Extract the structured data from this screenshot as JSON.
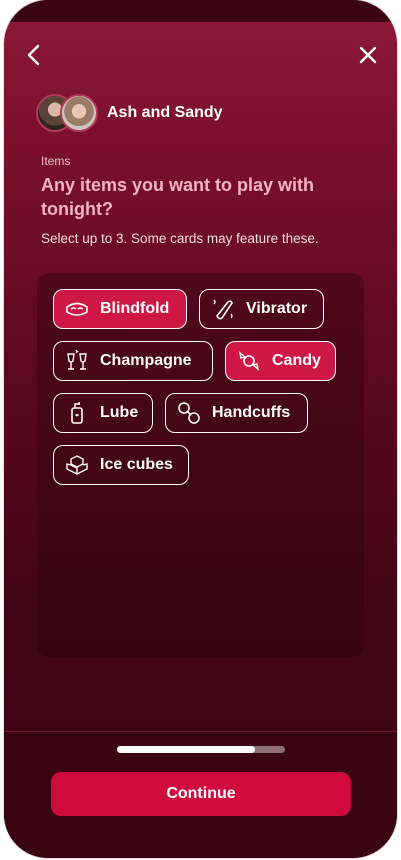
{
  "header": {
    "couple_name": "Ash and Sandy"
  },
  "question": {
    "section_label": "Items",
    "title": "Any items you want to play with tonight?",
    "hint": "Select up to 3. Some cards may feature these."
  },
  "items": [
    {
      "label": "Blindfold",
      "icon": "blindfold-icon",
      "selected": true
    },
    {
      "label": "Vibrator",
      "icon": "vibrator-icon",
      "selected": false
    },
    {
      "label": "Champagne",
      "icon": "champagne-icon",
      "selected": false
    },
    {
      "label": "Candy",
      "icon": "candy-icon",
      "selected": true
    },
    {
      "label": "Lube",
      "icon": "lube-icon",
      "selected": false
    },
    {
      "label": "Handcuffs",
      "icon": "handcuffs-icon",
      "selected": false
    },
    {
      "label": "Ice cubes",
      "icon": "ice-cubes-icon",
      "selected": false
    }
  ],
  "progress": {
    "fraction": 0.82
  },
  "footer": {
    "continue_label": "Continue"
  },
  "colors": {
    "accent": "#cf0a3d",
    "selected_chip": "#cf1746",
    "background_top": "#8e1838",
    "background_bottom": "#3a0413"
  }
}
